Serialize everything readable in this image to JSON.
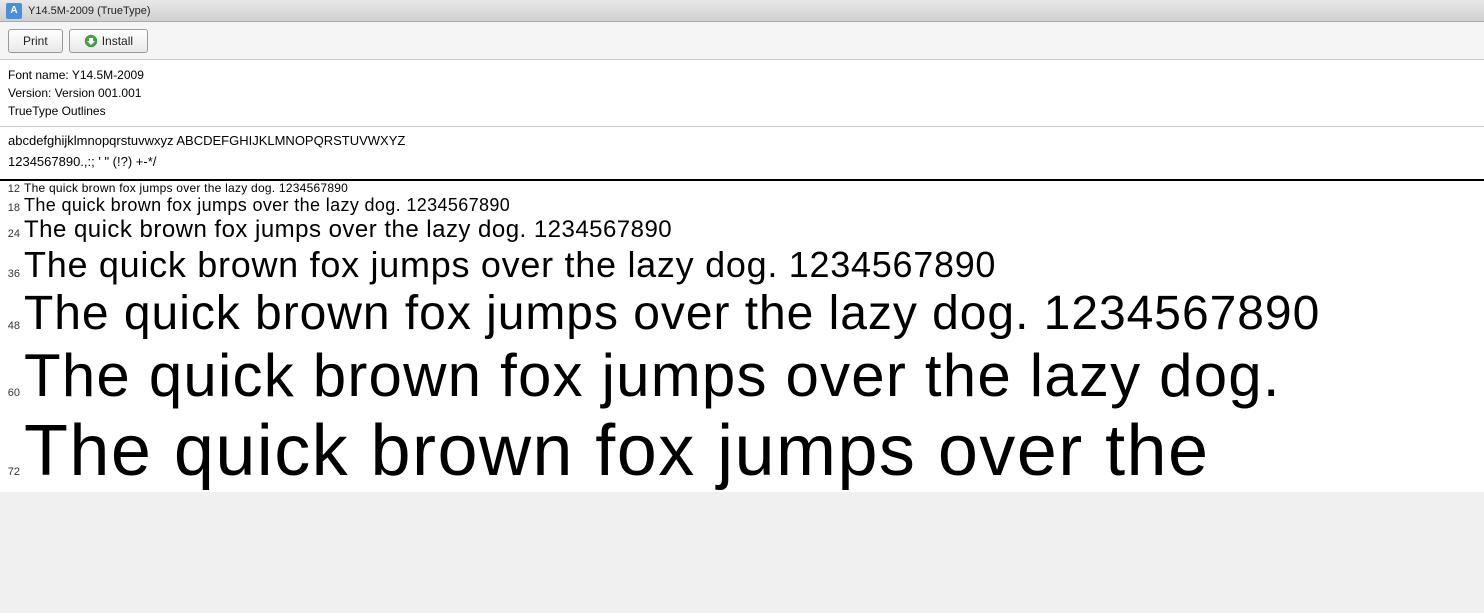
{
  "titleBar": {
    "title": "Y14.5M-2009 (TrueType)"
  },
  "toolbar": {
    "printLabel": "Print",
    "installLabel": "Install"
  },
  "info": {
    "fontName": "Font name: Y14.5M-2009",
    "version": "Version: Version 001.001",
    "type": "TrueType Outlines"
  },
  "alphabet": {
    "lowercase": "abcdefghijklmnopqrstuvwxyz  ABCDEFGHIJKLMNOPQRSTUVWXYZ",
    "numbers": "1234567890.,:;  '  \"  (!?)  +-*/"
  },
  "previewRows": [
    {
      "size": "12",
      "text": "The quick brown fox jumps over the lazy dog. 1234567890"
    },
    {
      "size": "18",
      "text": "The quick brown fox jumps over the lazy dog.  1234567890"
    },
    {
      "size": "24",
      "text": "The quick brown fox jumps over the lazy dog.  1234567890"
    },
    {
      "size": "36",
      "text": "The quick brown fox jumps over the lazy dog.  1234567890"
    },
    {
      "size": "48",
      "text": "The quick brown fox jumps over the lazy dog.  1234567890"
    },
    {
      "size": "60",
      "text": "The quick brown fox jumps over the lazy dog."
    },
    {
      "size": "72",
      "text": "The quick brown fox jumps over the"
    }
  ]
}
